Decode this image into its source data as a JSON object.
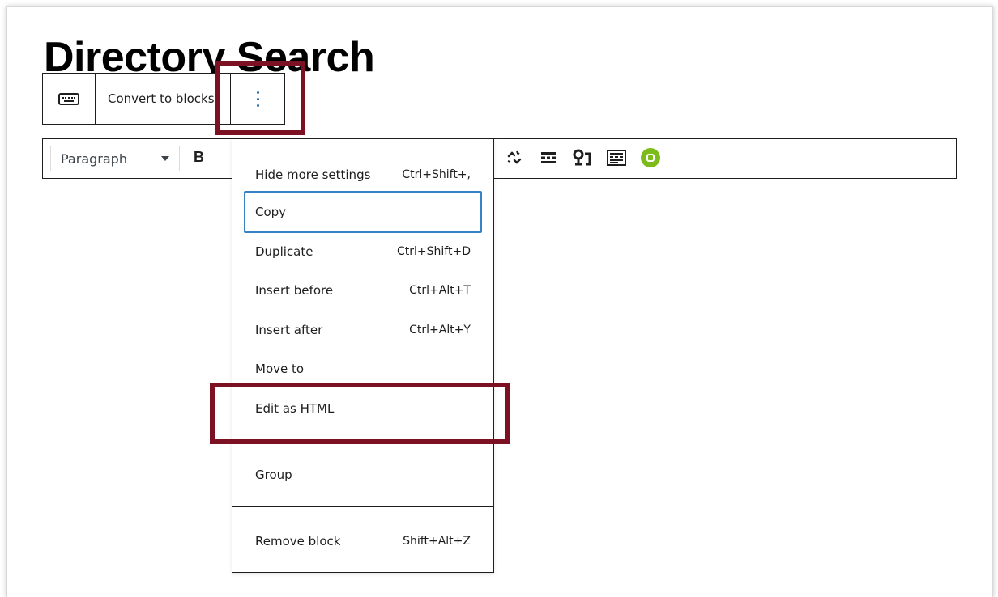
{
  "page": {
    "title": "Directory Search"
  },
  "block_toolbar": {
    "block_icon": "keyboard-icon",
    "convert_label": "Convert to blocks",
    "more_icon": "vertical-ellipsis-icon"
  },
  "classic_toolbar": {
    "format_select": "Paragraph",
    "bold_label": "B",
    "icons": [
      "unlink-icon",
      "read-more-icon",
      "shortcode-icon",
      "toolbar-toggle-icon",
      "green-addon-icon"
    ]
  },
  "menu": {
    "items": [
      {
        "label": "Hide more settings",
        "shortcut": "Ctrl+Shift+,"
      },
      {
        "label": "Copy",
        "shortcut": ""
      },
      {
        "label": "Duplicate",
        "shortcut": "Ctrl+Shift+D"
      },
      {
        "label": "Insert before",
        "shortcut": "Ctrl+Alt+T"
      },
      {
        "label": "Insert after",
        "shortcut": "Ctrl+Alt+Y"
      },
      {
        "label": "Move to",
        "shortcut": ""
      },
      {
        "label": "Edit as HTML",
        "shortcut": ""
      }
    ],
    "group_label": "Group",
    "remove": {
      "label": "Remove block",
      "shortcut": "Shift+Alt+Z"
    }
  },
  "colors": {
    "highlight": "#7b1122",
    "focus_ring": "#3582c4",
    "dots": "#2271b1",
    "addon_green": "#7dbb1b"
  }
}
